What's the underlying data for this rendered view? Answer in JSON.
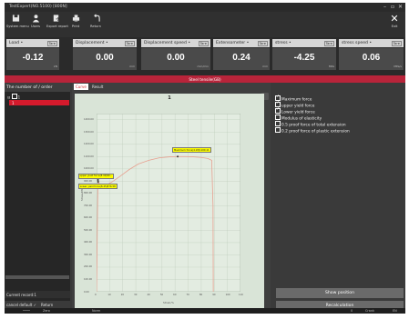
{
  "window": {
    "title": "TestExpert(NO.5100) [800N]",
    "min": "–",
    "max": "▫",
    "close": "✕"
  },
  "toolbar": [
    {
      "label": "System menu",
      "icon": "disk-icon"
    },
    {
      "label": "Users",
      "icon": "user-icon"
    },
    {
      "label": "Export report",
      "icon": "export-icon"
    },
    {
      "label": "Print",
      "icon": "print-icon"
    },
    {
      "label": "Return",
      "icon": "return-icon"
    }
  ],
  "exit": {
    "label": "Exit",
    "glyph": "✕"
  },
  "meters": [
    {
      "name": "Load •",
      "btn": "Tare",
      "value": "-0.12",
      "unit": "kN"
    },
    {
      "name": "Displacement •",
      "btn": "Tare",
      "value": "0.00",
      "unit": "mm"
    },
    {
      "name": "Displacement speed •",
      "btn": "Tare",
      "value": "0.00",
      "unit": "mm/min"
    },
    {
      "name": "Extensometer •",
      "btn": "Tare",
      "value": "0.24",
      "unit": "mm"
    },
    {
      "name": "stress •",
      "btn": "Tare",
      "value": "-4.25",
      "unit": "MPa"
    },
    {
      "name": "stress speed •",
      "btn": "Tare",
      "value": "0.06",
      "unit": "MPa/s"
    }
  ],
  "banner": "Steel tensile(GB)",
  "left": {
    "header": "The number of / order",
    "group": "1",
    "item": "1",
    "current": "Current record:1",
    "cancel": "cancel default ✓",
    "return": "Return"
  },
  "tabs": [
    {
      "label": "Curve"
    },
    {
      "label": "Result"
    }
  ],
  "chart_data": {
    "type": "line",
    "title": "1",
    "xlabel": "Strain/%",
    "ylabel": "Stress/MPa",
    "xlim": [
      0,
      110
    ],
    "ylim": [
      0,
      1450
    ],
    "x_ticks": [
      0,
      10,
      20,
      30,
      40,
      50,
      60,
      70,
      80,
      90,
      100,
      110
    ],
    "y_ticks": [
      0,
      100,
      200,
      300,
      400,
      500,
      600,
      700,
      800,
      900,
      1000,
      1100,
      1200,
      1300,
      1400
    ],
    "series": [
      {
        "x": [
          0,
          0.3,
          0.6,
          1,
          1.5,
          2,
          3,
          5,
          8,
          12,
          18,
          25,
          32,
          40,
          48,
          56,
          62,
          68,
          74,
          80,
          85,
          88,
          89,
          89.2
        ],
        "y": [
          0,
          250,
          550,
          870,
          900,
          880,
          860,
          855,
          870,
          895,
          940,
          995,
          1040,
          1070,
          1090,
          1098,
          1100,
          1100,
          1098,
          1093,
          1085,
          1070,
          700,
          0
        ],
        "color": "#e7a090"
      }
    ],
    "markers": [
      {
        "x": 62,
        "y": 1100,
        "label": "Maximum force(4.18)1100.11"
      },
      {
        "x": 1.2,
        "y": 895,
        "label": "Lower yield force(8.45)876.58"
      },
      {
        "x": 1.1,
        "y": 910,
        "label": "upper yield force(8.40)90..."
      }
    ],
    "grid": true,
    "legend": "none"
  },
  "right": {
    "options": [
      {
        "label": "Maximum force",
        "checked": true
      },
      {
        "label": "upper yield force",
        "checked": true
      },
      {
        "label": "Lower yield force",
        "checked": true
      },
      {
        "label": "Modulus of elasticity",
        "checked": false
      },
      {
        "label": "0.5 proof force of total extension",
        "checked": false
      },
      {
        "label": "0.2 proof force of plastic extension",
        "checked": false
      }
    ],
    "show_position": "Show position",
    "recalculation": "Recalculation"
  },
  "status": {
    "a": "••••",
    "b": "Zero",
    "c": "Norm",
    "d": "0",
    "e": "Crank",
    "f": "EN"
  }
}
